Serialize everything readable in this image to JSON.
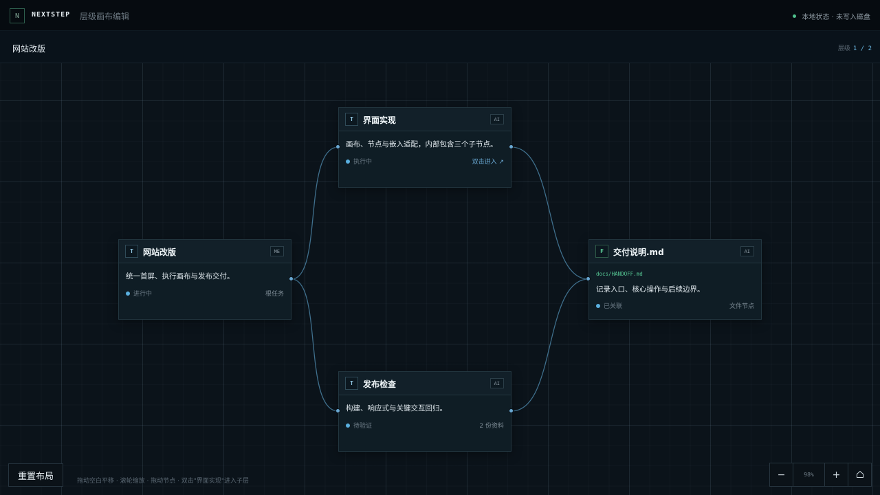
{
  "topbar": {
    "logo": "N",
    "brand": "NEXTSTEP",
    "subtitle": "层级画布编辑",
    "status_text": "本地状态 · 未写入磁盘"
  },
  "subbar": {
    "breadcrumb": "网站改版",
    "level_label": "层级",
    "level_value": "1 / 2"
  },
  "nodes": [
    {
      "id": "root",
      "type_icon": "T",
      "title": "网站改版",
      "owner": "ME",
      "description": "统一首屏、执行画布与发布交付。",
      "status": "进行中",
      "meta": "根任务"
    },
    {
      "id": "ui",
      "type_icon": "T",
      "title": "界面实现",
      "owner": "AI",
      "description": "画布、节点与嵌入适配，内部包含三个子节点。",
      "status": "执行中",
      "meta": "双击进入 ↗"
    },
    {
      "id": "release",
      "type_icon": "T",
      "title": "发布检查",
      "owner": "AI",
      "description": "构建、响应式与关键交互回归。",
      "status": "待验证",
      "meta": "2 份资料"
    },
    {
      "id": "handoff",
      "type_icon": "F",
      "title": "交付说明.md",
      "owner": "AI",
      "path": "docs/HANDOFF.md",
      "description": "记录入口、核心操作与后续边界。",
      "status": "已关联",
      "meta": "文件节点"
    }
  ],
  "controls": {
    "reset_label": "重置布局",
    "hint": "拖动空白平移 · 滚轮缩放 · 拖动节点 · 双击\"界面实现\"进入子层",
    "zoom_minus": "−",
    "zoom_value": "98%",
    "zoom_plus": "+",
    "home_icon": "home-icon"
  },
  "colors": {
    "accent": "#6aa9d4",
    "status_ok": "#4fc08d",
    "file_path": "#56c794",
    "edge": "#3f6f8c"
  }
}
